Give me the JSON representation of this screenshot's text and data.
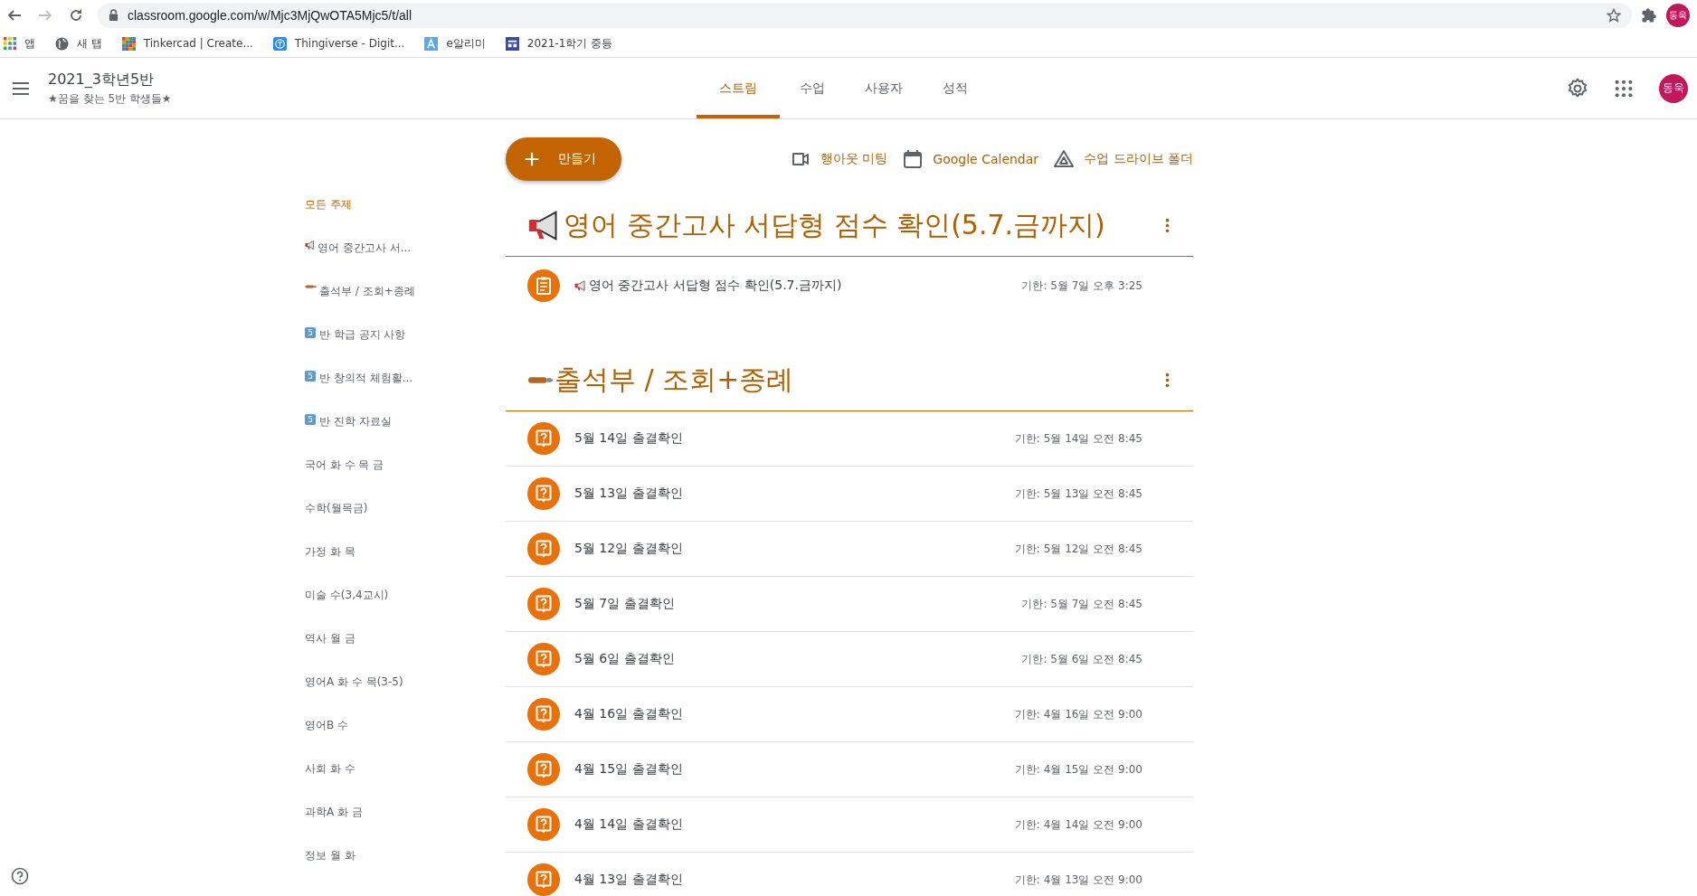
{
  "browser": {
    "url": "classroom.google.com/w/Mjc3MjQwOTA5Mjc5/t/all",
    "profile": "동욱",
    "bookmarks": [
      {
        "kind": "apps",
        "label": "앱"
      },
      {
        "kind": "globe",
        "label": "새 탭"
      },
      {
        "kind": "tinkercad",
        "label": "Tinkercad | Create..."
      },
      {
        "kind": "thingiverse",
        "label": "Thingiverse - Digit..."
      },
      {
        "kind": "alimi",
        "label": "e알리미"
      },
      {
        "kind": "layout",
        "label": "2021-1학기 중등"
      }
    ]
  },
  "header": {
    "class_name": "2021_3학년5반",
    "subtitle": "★꿈을 찾는 5반 학생들★",
    "avatar": "동욱",
    "tabs": [
      {
        "label": "스트림",
        "selected": true
      },
      {
        "label": "수업",
        "selected": false
      },
      {
        "label": "사용자",
        "selected": false
      },
      {
        "label": "성적",
        "selected": false
      }
    ]
  },
  "toolbar": {
    "create": "만들기",
    "links": [
      {
        "kind": "video",
        "label": "행아웃 미팅"
      },
      {
        "kind": "calendar",
        "label": "Google Calendar"
      },
      {
        "kind": "drive",
        "label": "수업 드라이브 폴더"
      }
    ]
  },
  "sidebar": {
    "items": [
      {
        "kind": "plain",
        "label": "모든 주제",
        "selected": true
      },
      {
        "kind": "megaphone",
        "label": "영어 중간고사 서...",
        "selected": false
      },
      {
        "kind": "pen",
        "label": "출석부 / 조회+종례",
        "selected": false
      },
      {
        "kind": "keycap",
        "keycap": "5",
        "label": "반 학급 공지 사항",
        "selected": false
      },
      {
        "kind": "keycap",
        "keycap": "5",
        "label": "반 창의적 체험활...",
        "selected": false
      },
      {
        "kind": "keycap",
        "keycap": "5",
        "label": "반 진학 자료실",
        "selected": false
      },
      {
        "kind": "plain",
        "label": "국어 화 수 목 금",
        "selected": false
      },
      {
        "kind": "plain",
        "label": "수학(월목금)",
        "selected": false
      },
      {
        "kind": "plain",
        "label": "가정 화 목",
        "selected": false
      },
      {
        "kind": "plain",
        "label": "미술 수(3,4교시)",
        "selected": false
      },
      {
        "kind": "plain",
        "label": "역사 월 금",
        "selected": false
      },
      {
        "kind": "plain",
        "label": "영어A 화 수 목(3-5)",
        "selected": false
      },
      {
        "kind": "plain",
        "label": "영어B 수",
        "selected": false
      },
      {
        "kind": "plain",
        "label": "사회 화 수",
        "selected": false
      },
      {
        "kind": "plain",
        "label": "과학A 화 금",
        "selected": false
      },
      {
        "kind": "plain",
        "label": "정보 월 화",
        "selected": false
      }
    ]
  },
  "topics": [
    {
      "kind": "megaphone",
      "title": "영어 중간고사 서답형 점수 확인(5.7.금까지)",
      "items": [
        {
          "kind": "megaphone-assignment",
          "title": "영어 중간고사 서답형 점수 확인(5.7.금까지)",
          "due": "기한: 5월 7일 오후 3:25"
        }
      ]
    },
    {
      "kind": "pen",
      "title": "출석부 / 조회+종례",
      "items": [
        {
          "kind": "question",
          "title": "5월 14일 출결확인",
          "due": "기한: 5월 14일 오전 8:45"
        },
        {
          "kind": "question",
          "title": "5월 13일 출결확인",
          "due": "기한: 5월 13일 오전 8:45"
        },
        {
          "kind": "question",
          "title": "5월 12일 출결확인",
          "due": "기한: 5월 12일 오전 8:45"
        },
        {
          "kind": "question",
          "title": "5월 7일 출결확인",
          "due": "기한: 5월 7일 오전 8:45"
        },
        {
          "kind": "question",
          "title": "5월 6일 출결확인",
          "due": "기한: 5월 6일 오전 8:45"
        },
        {
          "kind": "question",
          "title": "4월 16일 출결확인",
          "due": "기한: 4월 16일 오전 9:00"
        },
        {
          "kind": "question",
          "title": "4월 15일 출결확인",
          "due": "기한: 4월 15일 오전 9:00"
        },
        {
          "kind": "question",
          "title": "4월 14일 출결확인",
          "due": "기한: 4월 14일 오전 9:00"
        },
        {
          "kind": "question",
          "title": "4월 13일 출결확인",
          "due": "기한: 4월 13일 오전 9:00"
        }
      ]
    }
  ]
}
